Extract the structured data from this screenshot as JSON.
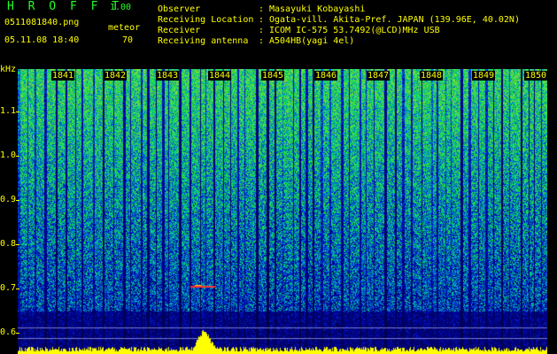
{
  "header": {
    "app_title": "H R O F F T",
    "app_version": "1.00",
    "file_name": "0511081840.png",
    "meteor_label": "meteor",
    "datetime": "05.11.08 18:40",
    "meteor_count": "70"
  },
  "info": [
    {
      "label": "Observer",
      "value": "Masayuki Kobayashi"
    },
    {
      "label": "Receiving Location",
      "value": "Ogata-vill. Akita-Pref. JAPAN (139.96E, 40.02N)"
    },
    {
      "label": "Receiver",
      "value": "ICOM IC-575 53.7492(@LCD)MHz USB"
    },
    {
      "label": "Receiving antenna",
      "value": "A504HB(yagi 4el)"
    }
  ],
  "axis": {
    "y_unit": "kHz",
    "y_ticks": [
      "1.1",
      "1.0",
      "0.9",
      "0.8",
      "0.7",
      "0.6"
    ],
    "minutes": [
      "1841",
      "1842",
      "1843",
      "1844",
      "1845",
      "1846",
      "1847",
      "1848",
      "1849",
      "1850"
    ]
  },
  "colors": {
    "foreground": "#ffff00",
    "title": "#22ff22",
    "background": "#000000"
  }
}
